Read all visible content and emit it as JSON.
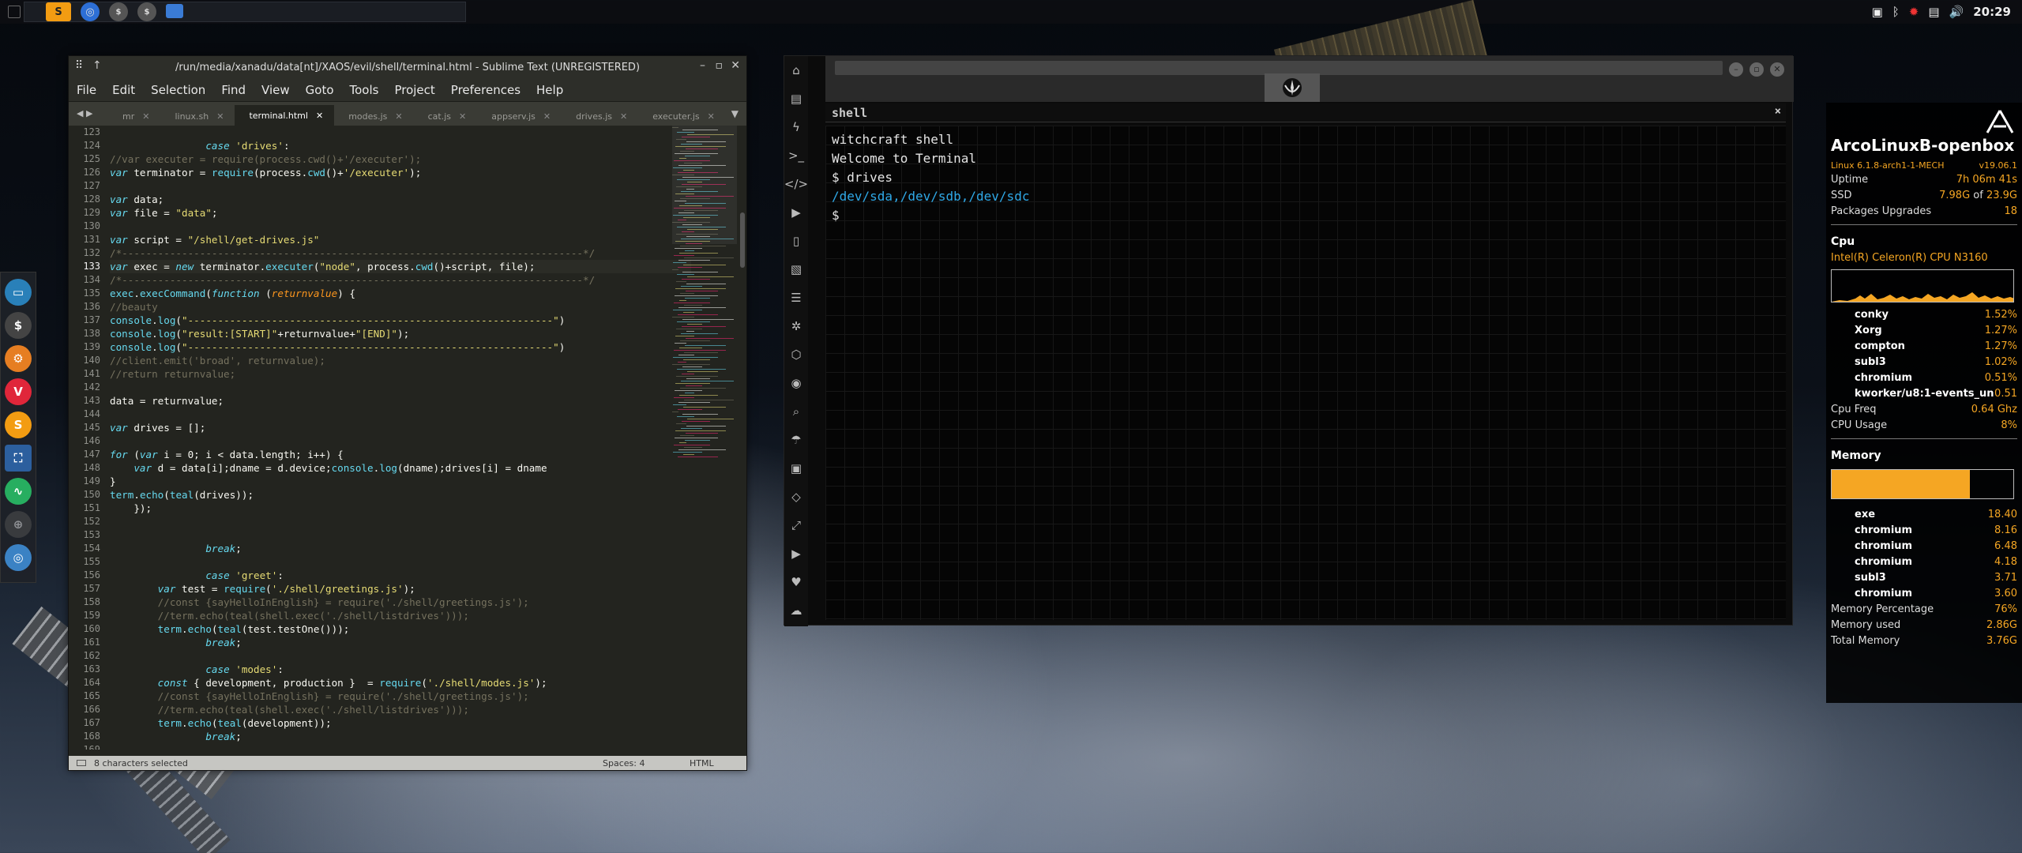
{
  "taskbar": {
    "launchers": [
      "sublime-icon",
      "firefox-icon",
      "terminal-icon",
      "terminal-icon-2",
      "files-icon"
    ],
    "clock": "20:29"
  },
  "sublime": {
    "title": "/run/media/xanadu/data[nt]/XAOS/evil/shell/terminal.html - Sublime Text (UNREGISTERED)",
    "menu": [
      "File",
      "Edit",
      "Selection",
      "Find",
      "View",
      "Goto",
      "Tools",
      "Project",
      "Preferences",
      "Help"
    ],
    "tabs": [
      "mr",
      "linux.sh",
      "terminal.html",
      "modes.js",
      "cat.js",
      "appserv.js",
      "drives.js",
      "executer.js"
    ],
    "active_tab": "terminal.html",
    "status_left": "8 characters selected",
    "status_spaces": "Spaces: 4",
    "status_syntax": "HTML",
    "lines": [
      {
        "n": "123",
        "t": ""
      },
      {
        "n": "124",
        "t": "                case 'drives':"
      },
      {
        "n": "125",
        "t": "//var executer = require(process.cwd()+'/executer');"
      },
      {
        "n": "126",
        "t": "var terminator = require(process.cwd()+'/executer');"
      },
      {
        "n": "127",
        "t": ""
      },
      {
        "n": "128",
        "t": "var data;"
      },
      {
        "n": "129",
        "t": "var file = \"data\";"
      },
      {
        "n": "130",
        "t": ""
      },
      {
        "n": "131",
        "t": "var script = \"/shell/get-drives.js\""
      },
      {
        "n": "132",
        "t": "/*-----------------------------------------------------------------------------*/"
      },
      {
        "n": "133",
        "t": "var exec = new terminator.executer(\"node\", process.cwd()+script, file);"
      },
      {
        "n": "134",
        "t": "/*-----------------------------------------------------------------------------*/"
      },
      {
        "n": "135",
        "t": "exec.execCommand(function (returnvalue) {"
      },
      {
        "n": "136",
        "t": "//beauty"
      },
      {
        "n": "137",
        "t": "console.log(\"-------------------------------------------------------------\")"
      },
      {
        "n": "138",
        "t": "console.log(\"result:[START]\"+returnvalue+\"[END]\");"
      },
      {
        "n": "139",
        "t": "console.log(\"-------------------------------------------------------------\")"
      },
      {
        "n": "140",
        "t": "//client.emit('broad', returnvalue);"
      },
      {
        "n": "141",
        "t": "//return returnvalue;"
      },
      {
        "n": "142",
        "t": ""
      },
      {
        "n": "143",
        "t": "data = returnvalue;"
      },
      {
        "n": "144",
        "t": ""
      },
      {
        "n": "145",
        "t": "var drives = [];"
      },
      {
        "n": "146",
        "t": ""
      },
      {
        "n": "147",
        "t": "for (var i = 0; i < data.length; i++) {"
      },
      {
        "n": "148",
        "t": "    var d = data[i];dname = d.device;console.log(dname);drives[i] = dname"
      },
      {
        "n": "149",
        "t": "}"
      },
      {
        "n": "150",
        "t": "term.echo(teal(drives));"
      },
      {
        "n": "151",
        "t": "    });"
      },
      {
        "n": "152",
        "t": ""
      },
      {
        "n": "153",
        "t": ""
      },
      {
        "n": "154",
        "t": "                break;"
      },
      {
        "n": "155",
        "t": ""
      },
      {
        "n": "156",
        "t": "                case 'greet':"
      },
      {
        "n": "157",
        "t": "        var test = require('./shell/greetings.js');"
      },
      {
        "n": "158",
        "t": "        //const {sayHelloInEnglish} = require('./shell/greetings.js');"
      },
      {
        "n": "159",
        "t": "        //term.echo(teal(shell.exec('./shell/listdrives')));"
      },
      {
        "n": "160",
        "t": "        term.echo(teal(test.testOne()));"
      },
      {
        "n": "161",
        "t": "                break;"
      },
      {
        "n": "162",
        "t": ""
      },
      {
        "n": "163",
        "t": "                case 'modes':"
      },
      {
        "n": "164",
        "t": "        const { development, production }  = require('./shell/modes.js');"
      },
      {
        "n": "165",
        "t": "        //const {sayHelloInEnglish} = require('./shell/greetings.js');"
      },
      {
        "n": "166",
        "t": "        //term.echo(teal(shell.exec('./shell/listdrives')));"
      },
      {
        "n": "167",
        "t": "        term.echo(teal(development));"
      },
      {
        "n": "168",
        "t": "                break;"
      },
      {
        "n": "169",
        "t": ""
      }
    ]
  },
  "terminal": {
    "header": "shell",
    "close": "×",
    "lines": [
      {
        "t": "witchcraft shell",
        "kind": "text"
      },
      {
        "t": "Welcome to Terminal",
        "kind": "text"
      },
      {
        "t": "$ drives",
        "kind": "text"
      },
      {
        "t": "/dev/sda,/dev/sdb,/dev/sdc",
        "kind": "out"
      },
      {
        "t": "$",
        "kind": "text"
      }
    ]
  },
  "conky": {
    "title": "ArcoLinuxB-openbox",
    "kernel": "Linux 6.1.8-arch1-1-MECH",
    "kernel_version": "v19.06.1",
    "uptime_label": "Uptime",
    "uptime": "7h 06m 41s",
    "ssd_label": "SSD",
    "ssd_used": "7.98G",
    "ssd_of": "of",
    "ssd_total": "23.9G",
    "pkg_label": "Packages Upgrades",
    "pkg": "18",
    "cpu_label": "Cpu",
    "cpu_model": "Intel(R) Celeron(R) CPU  N3160",
    "cpu_procs": [
      {
        "name": "conky",
        "v": "1.52%"
      },
      {
        "name": "Xorg",
        "v": "1.27%"
      },
      {
        "name": "compton",
        "v": "1.27%"
      },
      {
        "name": "subl3",
        "v": "1.02%"
      },
      {
        "name": "chromium",
        "v": "0.51%"
      },
      {
        "name": "kworker/u8:1-events_un",
        "v": "0.51"
      }
    ],
    "cpu_freq_label": "Cpu Freq",
    "cpu_freq": "0.64 Ghz",
    "cpu_usage_label": "CPU Usage",
    "cpu_usage": "8%",
    "mem_label": "Memory",
    "mem_procs": [
      {
        "name": "exe",
        "v": "18.40"
      },
      {
        "name": "chromium",
        "v": "8.16"
      },
      {
        "name": "chromium",
        "v": "6.48"
      },
      {
        "name": "chromium",
        "v": "4.18"
      },
      {
        "name": "subl3",
        "v": "3.71"
      },
      {
        "name": "chromium",
        "v": "3.60"
      }
    ],
    "mem_pct_label": "Memory Percentage",
    "mem_pct": "76%",
    "mem_used_label": "Memory used",
    "mem_used": "2.86G",
    "mem_total_label": "Total Memory",
    "mem_total": "3.76G",
    "accent": "#f5a623"
  },
  "dock": {
    "icons": [
      "files-icon",
      "terminal-icon",
      "settings-icon",
      "vivaldi-icon",
      "sublime-icon",
      "screenshot-icon",
      "monitor-icon",
      "network-icon",
      "chromium-icon"
    ]
  }
}
